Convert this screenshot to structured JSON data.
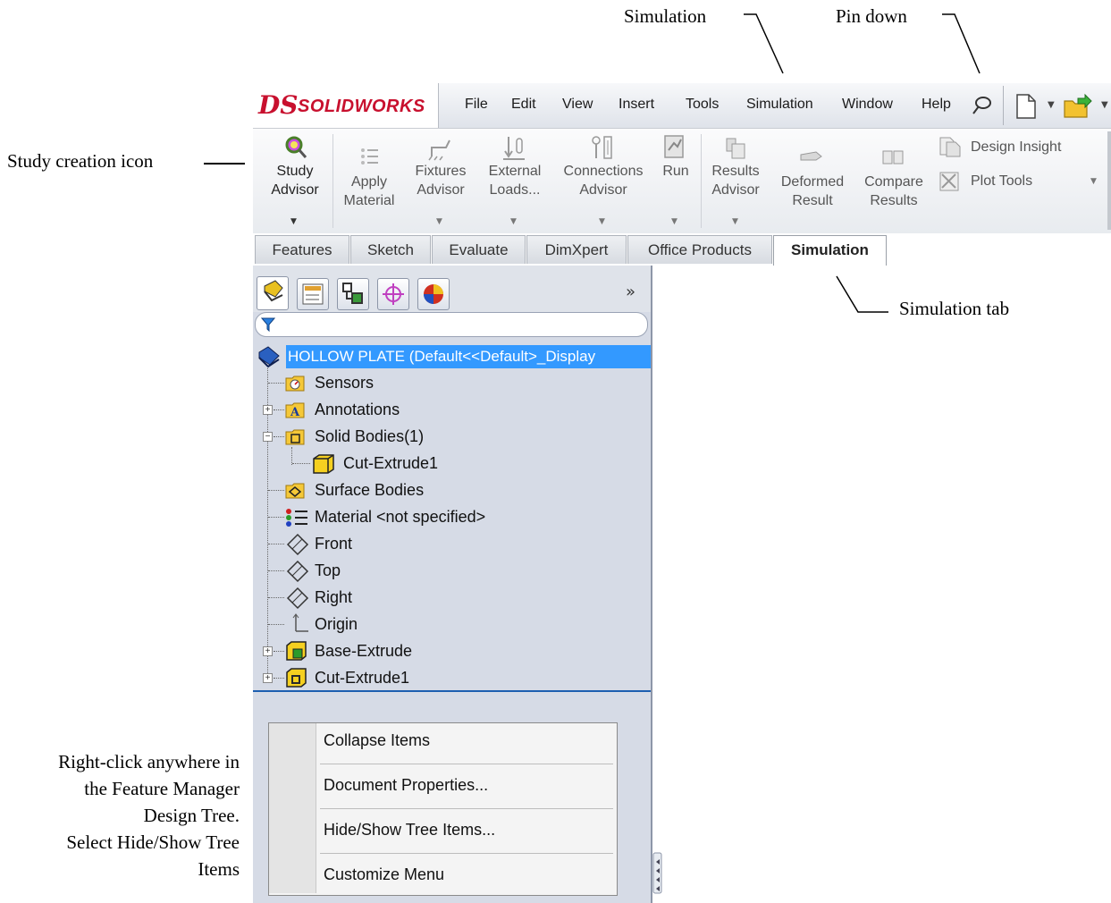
{
  "callouts": {
    "simulation": "Simulation",
    "pin_down": "Pin down",
    "study_creation": "Study creation icon",
    "simulation_tab": "Simulation tab",
    "right_click_l1": "Right-click anywhere in",
    "right_click_l2": "the Feature Manager",
    "right_click_l3": "Design Tree.",
    "right_click_l4": "Select Hide/Show Tree",
    "right_click_l5": "Items"
  },
  "logo": {
    "ds": "DS",
    "brand": "SOLIDWORKS"
  },
  "menu": [
    "File",
    "Edit",
    "View",
    "Insert",
    "Tools",
    "Simulation",
    "Window",
    "Help"
  ],
  "ribbon": {
    "study_advisor": [
      "Study",
      "Advisor"
    ],
    "apply_material": [
      "Apply",
      "Material"
    ],
    "fixtures_advisor": [
      "Fixtures",
      "Advisor"
    ],
    "external_loads": [
      "External",
      "Loads..."
    ],
    "connections_advisor": [
      "Connections",
      "Advisor"
    ],
    "run": "Run",
    "results_advisor": [
      "Results",
      "Advisor"
    ],
    "deformed_result": [
      "Deformed",
      "Result"
    ],
    "compare_results": [
      "Compare",
      "Results"
    ],
    "design_insight": "Design Insight",
    "plot_tools": "Plot Tools"
  },
  "tabs": [
    "Features",
    "Sketch",
    "Evaluate",
    "DimXpert",
    "Office Products",
    "Simulation"
  ],
  "active_tab": "Simulation",
  "tree": {
    "root": "HOLLOW PLATE  (Default<<Default>_Display",
    "items": [
      "Sensors",
      "Annotations",
      "Solid Bodies(1)",
      "Cut-Extrude1",
      "Surface Bodies",
      "Material <not specified>",
      "Front",
      "Top",
      "Right",
      "Origin",
      "Base-Extrude",
      "Cut-Extrude1"
    ]
  },
  "fm_expand": "»",
  "context_menu": [
    "Collapse Items",
    "Document Properties...",
    "Hide/Show Tree Items...",
    "Customize Menu"
  ],
  "colors": {
    "brand_red": "#c8102e",
    "selection": "#3399ff",
    "tree_bg": "#d6dbe6"
  }
}
